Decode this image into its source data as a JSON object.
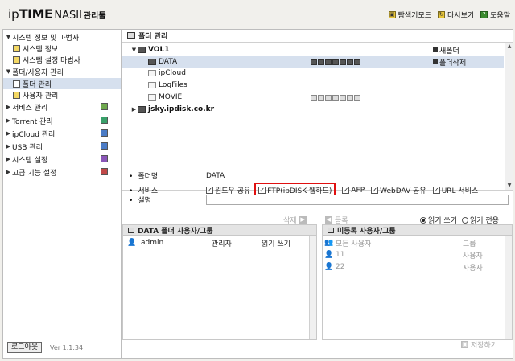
{
  "header": {
    "logo_ip": "ip",
    "logo_time": "TIME",
    "logo_nas": "NASII",
    "logo_admin": "관리툴",
    "links": [
      {
        "label": "탐색기모드"
      },
      {
        "label": "다시보기"
      },
      {
        "label": "도움말"
      }
    ]
  },
  "sidebar": {
    "items": [
      {
        "label": "시스템 정보 및 마법사"
      },
      {
        "label": "시스템 정보"
      },
      {
        "label": "시스템 설정 마법사"
      },
      {
        "label": "폴더/사용자 관리"
      },
      {
        "label": "폴더 관리"
      },
      {
        "label": "사용자 관리"
      },
      {
        "label": "서비스 관리"
      },
      {
        "label": "Torrent 관리"
      },
      {
        "label": "ipCloud 관리"
      },
      {
        "label": "USB 관리"
      },
      {
        "label": "시스템 설정"
      },
      {
        "label": "고급 기능 설정"
      }
    ],
    "logout": "로그아웃",
    "version": "Ver 1.1.34"
  },
  "main": {
    "title": "폴더 관리",
    "tree": {
      "volume": "VOL1",
      "folders": [
        {
          "name": "DATA"
        },
        {
          "name": "ipCloud"
        },
        {
          "name": "LogFiles"
        },
        {
          "name": "MOVIE"
        }
      ],
      "remote": "jsky.ipdisk.co.kr",
      "new_folder": "새폴더",
      "delete_folder": "폴더삭제"
    },
    "details": {
      "folder_name_label": "폴더명",
      "folder_name_value": "DATA",
      "service_label": "서비스",
      "desc_label": "설명",
      "services": [
        {
          "label": "윈도우 공유",
          "checked": true
        },
        {
          "label": "FTP(ipDISK 웹하드)",
          "checked": true,
          "highlighted": true
        },
        {
          "label": "AFP",
          "checked": true
        },
        {
          "label": "WebDAV 공유",
          "checked": true
        },
        {
          "label": "URL 서비스",
          "checked": true
        }
      ]
    },
    "permissions": {
      "delete_btn": "삭제",
      "register_btn": "등록",
      "radio_rw": "읽기 쓰기",
      "radio_r": "읽기 전용",
      "radio_selected": "읽기 쓰기",
      "left_panel": {
        "title": "DATA 폴더 사용자/그룹",
        "rows": [
          {
            "name": "admin",
            "role": "관리자",
            "perm": "읽기 쓰기"
          }
        ]
      },
      "right_panel": {
        "title": "미등록 사용자/그룹",
        "header": {
          "name": "모든 사용자",
          "type": "그룹"
        },
        "rows": [
          {
            "name": "11",
            "type": "사용자"
          },
          {
            "name": "22",
            "type": "사용자"
          }
        ]
      },
      "save": "저장하기"
    }
  }
}
